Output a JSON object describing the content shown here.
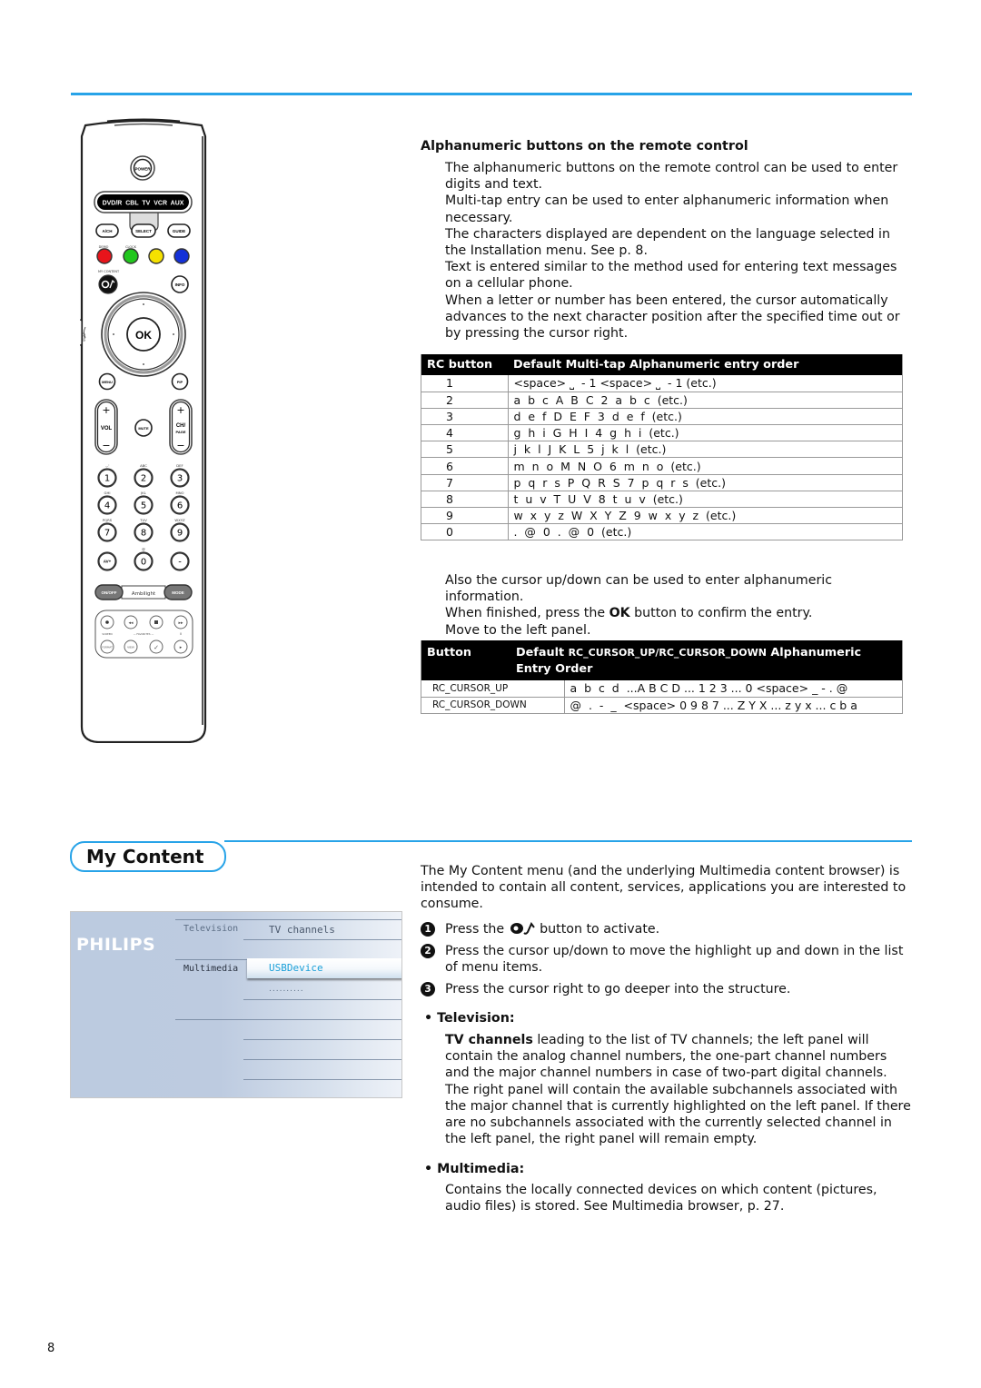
{
  "page_number": "8",
  "colors": {
    "accent": "#27a3e8",
    "table_header_bg": "#000000",
    "highlight_text": "#1a9fd8"
  },
  "remote": {
    "power_label": "POWER",
    "source_bar": "DVD/R  CBL  TV  VCR  AUX",
    "ach_label": "A/CH",
    "select_label": "SELECT",
    "guide_label": "GUIDE",
    "demo_label": "DEMO",
    "clock_label": "CLOCK",
    "color_keys": [
      "#e8141b",
      "#22c71e",
      "#f5e100",
      "#1431d8"
    ],
    "my_content_label": "MY CONTENT",
    "info_label": "INFO",
    "ok_label": "OK",
    "swap_label": "SWAP",
    "menu_label": "MENU",
    "pip_label": "PIP",
    "vol_label": "VOL",
    "mute_label": "MUTE",
    "ch_label": "CH/",
    "page_label": "PAGE",
    "plus": "+",
    "minus": "−",
    "digits": [
      {
        "d": "1",
        "sub": ".,-'"
      },
      {
        "d": "2",
        "sub": "ABC"
      },
      {
        "d": "3",
        "sub": "DEF"
      },
      {
        "d": "4",
        "sub": "GHI"
      },
      {
        "d": "5",
        "sub": "JKL"
      },
      {
        "d": "6",
        "sub": "MNO"
      },
      {
        "d": "7",
        "sub": "PQRS"
      },
      {
        "d": "8",
        "sub": "TUV"
      },
      {
        "d": "9",
        "sub": "WXYZ"
      },
      {
        "d": "AV+",
        "sub": ""
      },
      {
        "d": "0",
        "sub": "@"
      },
      {
        "d": "-",
        "sub": ""
      }
    ],
    "onoff_label": "ON/OFF",
    "ambilight_label": "Ambilight",
    "mode_label": "MODE",
    "screen_format_label": "SCREEN",
    "format_label": "FORMAT",
    "favorites_label": "— FAVORITES —",
    "view_label": "VIEW",
    "pause_label": "II"
  },
  "alpha": {
    "heading": "Alphanumeric buttons on the remote control",
    "paragraphs": [
      "The alphanumeric buttons on the remote control can be used to enter digits and text.",
      "Multi-tap entry can be used to enter alphanumeric information when necessary.",
      "The characters displayed are dependent on the language selected in the Installation menu. See p. 8.",
      "Text is entered similar to the method used for entering text messages on a cellular phone.",
      "When a letter or number has been entered, the cursor automatically advances to the next character position after the specified time out or by pressing the cursor right."
    ],
    "table1": {
      "headers": [
        "RC button",
        "Default Multi-tap Alphanumeric entry order"
      ],
      "rows": [
        [
          "1",
          "<space> ⎵  - 1 <space> ⎵  - 1 (etc.)"
        ],
        [
          "2",
          "a  b  c  A  B  C  2  a  b  c  (etc.)"
        ],
        [
          "3",
          "d  e  f  D  E  F  3  d  e  f  (etc.)"
        ],
        [
          "4",
          "g  h  i  G  H  I  4  g  h  i  (etc.)"
        ],
        [
          "5",
          "j  k  l  J  K  L  5  j  k  l  (etc.)"
        ],
        [
          "6",
          "m  n  o  M  N  O  6  m  n  o  (etc.)"
        ],
        [
          "7",
          "p  q  r  s  P  Q  R  S  7  p  q  r  s  (etc.)"
        ],
        [
          "8",
          "t  u  v  T  U  V  8  t  u  v  (etc.)"
        ],
        [
          "9",
          "w  x  y  z  W  X  Y  Z  9  w  x  y  z  (etc.)"
        ],
        [
          "0",
          ".  @  0  .  @  0  (etc.)"
        ]
      ]
    },
    "after_text_1": "Also the cursor up/down can be used to enter alphanumeric information.",
    "after_text_2_pre": "When finished, press the ",
    "after_text_2_bold": "OK",
    "after_text_2_post": " button to confirm the entry.",
    "after_text_3": "Move to the left panel.",
    "table2": {
      "header_button": "Button",
      "header_default": "Default ",
      "header_code": "RC_CURSOR_UP/RC_CURSOR_DOWN",
      "header_rest": " Alphanumeric",
      "header_line2": "Entry Order",
      "rows": [
        [
          "RC_CURSOR_UP",
          "a  b  c  d  ...A B C D ... 1 2 3 ... 0 <space> _ - . @"
        ],
        [
          "RC_CURSOR_DOWN",
          "@  .  -  _  <space> 0 9 8 7 ... Z Y X ... z y x ... c b a"
        ]
      ]
    }
  },
  "my_content": {
    "title": "My Content",
    "tv_menu": {
      "brand": "PHILIPS",
      "left_items": [
        "Television",
        "Multimedia"
      ],
      "right_items": [
        "TV channels",
        "USBDevice",
        ".........."
      ],
      "highlighted": "USBDevice"
    },
    "intro": "The My Content menu (and the underlying Multimedia content browser) is intended to contain all content, services, applications you are interested to consume.",
    "steps": [
      {
        "n": "1",
        "pre": "Press the ",
        "icon": "my-content-icon",
        "post": " button to activate."
      },
      {
        "n": "2",
        "text": "Press the cursor up/down to move the highlight up and down in the list of menu items."
      },
      {
        "n": "3",
        "text": "Press the cursor right to go deeper into the structure."
      }
    ],
    "television": {
      "heading": "• Television:",
      "bold": "TV channels",
      "text": " leading to the list of TV channels; the left panel will contain the analog channel numbers, the one-part channel numbers and the major channel numbers in case of two-part digital channels. The right panel will contain the available subchannels associated with the major channel that is currently highlighted on the left panel. If there are no subchannels associated with the currently selected channel in the left panel, the right panel will remain empty."
    },
    "multimedia": {
      "heading": "• Multimedia:",
      "text": "Contains the locally connected devices on which content (pictures, audio files) is stored. See Multimedia browser, p. 27."
    }
  }
}
